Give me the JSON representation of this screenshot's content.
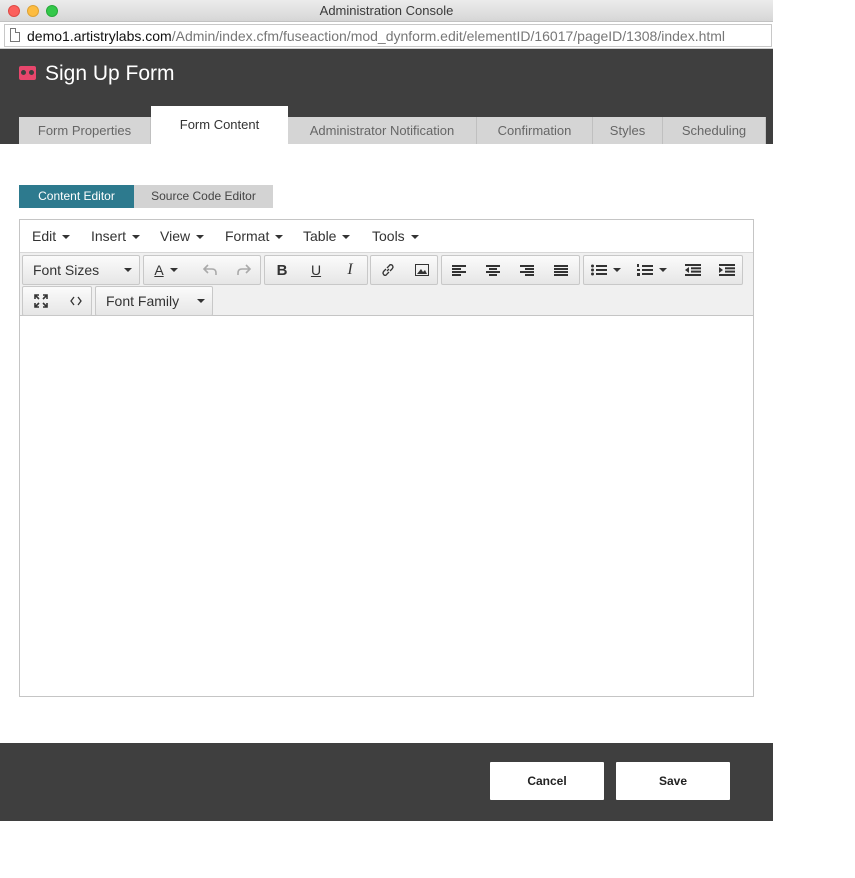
{
  "window": {
    "title": "Administration Console"
  },
  "urlbar": {
    "domain": "demo1.artistrylabs.com",
    "path": "/Admin/index.cfm/fuseaction/mod_dynform.edit/elementID/16017/pageID/1308/index.html"
  },
  "header": {
    "title": "Sign Up Form"
  },
  "tabs": [
    {
      "label": "Form Properties"
    },
    {
      "label": "Form Content"
    },
    {
      "label": "Administrator Notification"
    },
    {
      "label": "Confirmation"
    },
    {
      "label": "Styles"
    },
    {
      "label": "Scheduling"
    }
  ],
  "active_tab": "Form Content",
  "editor_modes": {
    "content": "Content Editor",
    "source": "Source Code Editor",
    "active": "Content Editor"
  },
  "menubar": [
    {
      "label": "Edit"
    },
    {
      "label": "Insert"
    },
    {
      "label": "View"
    },
    {
      "label": "Format"
    },
    {
      "label": "Table"
    },
    {
      "label": "Tools"
    }
  ],
  "toolbar": {
    "font_sizes": "Font Sizes",
    "font_family": "Font Family",
    "text_color_glyph": "A",
    "bold_glyph": "B",
    "underline_glyph": "U",
    "italic_glyph": "I"
  },
  "footer": {
    "cancel_label": "Cancel",
    "save_label": "Save"
  },
  "colors": {
    "header_bg": "#3f3f3f",
    "accent": "#2d7a8e",
    "logo": "#e8466c",
    "tab_inactive": "#d5d5d5"
  }
}
